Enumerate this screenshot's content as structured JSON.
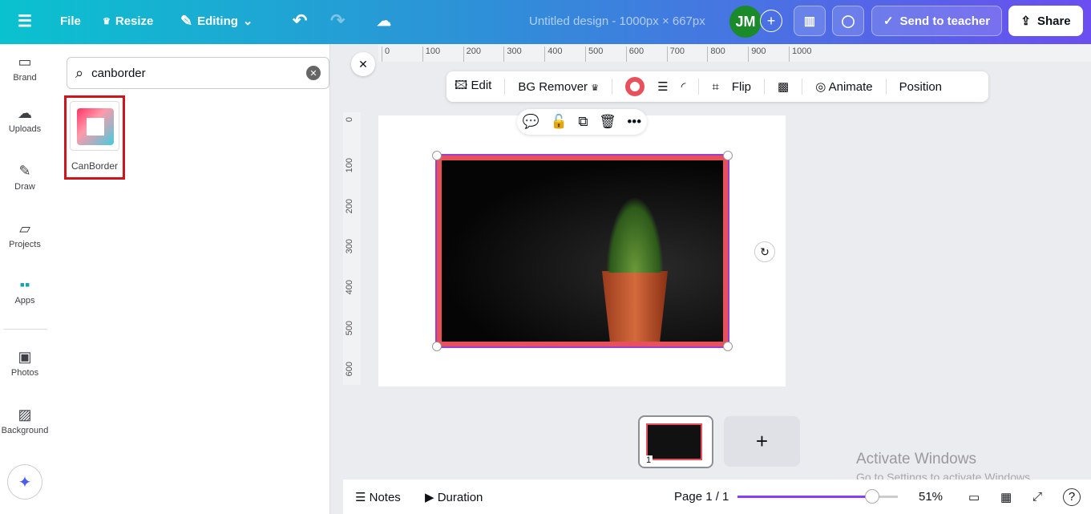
{
  "topbar": {
    "file": "File",
    "resize": "Resize",
    "editing": "Editing",
    "title": "Untitled design - 1000px × 667px",
    "avatar": "JM",
    "send": "Send to teacher",
    "share": "Share"
  },
  "rail": [
    {
      "label": "Brand",
      "icon": "brand-icon"
    },
    {
      "label": "Uploads",
      "icon": "upload-icon"
    },
    {
      "label": "Draw",
      "icon": "draw-icon"
    },
    {
      "label": "Projects",
      "icon": "folder-icon"
    },
    {
      "label": "Apps",
      "icon": "apps-icon"
    },
    {
      "label": "Photos",
      "icon": "photo-icon"
    },
    {
      "label": "Background",
      "icon": "background-icon"
    }
  ],
  "search": {
    "value": "canborder"
  },
  "result": {
    "label": "CanBorder"
  },
  "ruler_h": [
    "0",
    "100",
    "200",
    "300",
    "400",
    "500",
    "600",
    "700",
    "800",
    "900",
    "1000"
  ],
  "ruler_v": [
    "0",
    "100",
    "200",
    "300",
    "400",
    "500",
    "600"
  ],
  "toolbar": {
    "edit": "Edit",
    "bg": "BG Remover",
    "flip": "Flip",
    "animate": "Animate",
    "position": "Position",
    "border_color": "#e8505b"
  },
  "page_thumb": {
    "number": "1"
  },
  "footer": {
    "notes": "Notes",
    "duration": "Duration",
    "page": "Page 1 / 1",
    "zoom": "51%",
    "zoom_value": 51
  },
  "watermark": {
    "line1": "Activate Windows",
    "line2": "Go to Settings to activate Windows."
  }
}
